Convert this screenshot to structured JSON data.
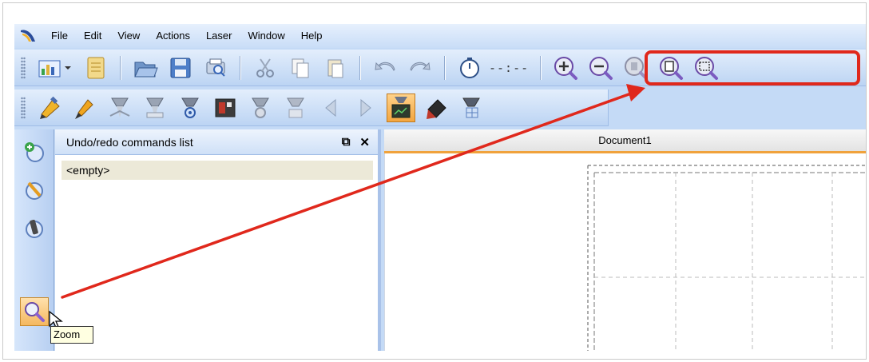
{
  "menu": {
    "items": [
      "File",
      "Edit",
      "View",
      "Actions",
      "Laser",
      "Window",
      "Help"
    ]
  },
  "toolbar1": {
    "timer_text": "--:--"
  },
  "panel": {
    "title": "Undo/redo commands list",
    "list": [
      "<empty>"
    ]
  },
  "document": {
    "tab": "Document1"
  },
  "leftbar": {
    "tooltip": "Zoom"
  },
  "colors": {
    "annotation": "#e0281c",
    "toolbar_bg": "#c4daf6",
    "active_button": "#f3a640"
  }
}
